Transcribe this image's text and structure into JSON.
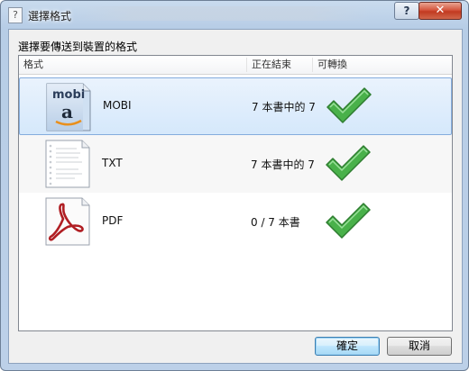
{
  "window": {
    "title": "選擇格式",
    "help_label": "?",
    "close_label": "✕",
    "app_icon_glyph": "?"
  },
  "dialog": {
    "prompt": "選擇要傳送到裝置的格式",
    "columns": {
      "format": "格式",
      "in_progress": "正在結束",
      "convertible": "可轉換"
    },
    "rows": [
      {
        "icon": "mobi-file-icon",
        "icon_text": "mobi",
        "icon_letter": "a",
        "format": "MOBI",
        "progress": "7 本書中的 7",
        "convertible": "check-icon",
        "selected": true
      },
      {
        "icon": "txt-file-icon",
        "format": "TXT",
        "progress": "7 本書中的 7",
        "convertible": "check-icon",
        "selected": false
      },
      {
        "icon": "pdf-file-icon",
        "format": "PDF",
        "progress": "0 / 7 本書",
        "convertible": "check-icon",
        "selected": false
      }
    ],
    "ok_label": "確定",
    "cancel_label": "取消"
  },
  "colors": {
    "check_green": "#3fa63f",
    "selection_border": "#84acdd",
    "pdf_red": "#b01e23"
  }
}
